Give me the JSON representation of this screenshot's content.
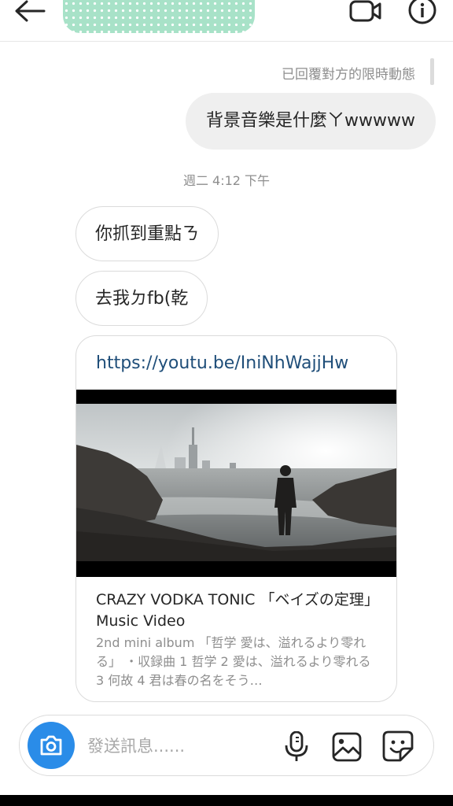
{
  "header": {
    "contact_name": ""
  },
  "thread": {
    "reply_note": "已回覆對方的限時動態",
    "outgoing_message": "背景音樂是什麼ㄚwwwww",
    "timestamp": "週二 4:12 下午",
    "incoming_messages": [
      "你抓到重點ㄋ",
      "去我ㄉfb(乾"
    ],
    "link_preview": {
      "url": "https://youtu.be/IniNhWajjHw",
      "title": "CRAZY VODKA TONIC 「ベイズの定理」Music Video",
      "description": "2nd mini album 「哲学 愛は、溢れるより零れる」 ・収録曲 1 哲学 2 愛は、溢れるより零れる 3 何故 4 君は春の名をそう…"
    }
  },
  "composer": {
    "placeholder": "發送訊息......"
  },
  "colors": {
    "camera_button": "#2a8ce8",
    "link_text": "#1f4e79",
    "outgoing_bubble": "#efefef",
    "secondary_text": "#8e8e8e"
  },
  "icons": {
    "back": "back-arrow-icon",
    "video_call": "video-camera-icon",
    "info": "info-icon",
    "camera": "camera-icon",
    "mic": "microphone-icon",
    "gallery": "gallery-icon",
    "sticker": "sticker-icon"
  }
}
